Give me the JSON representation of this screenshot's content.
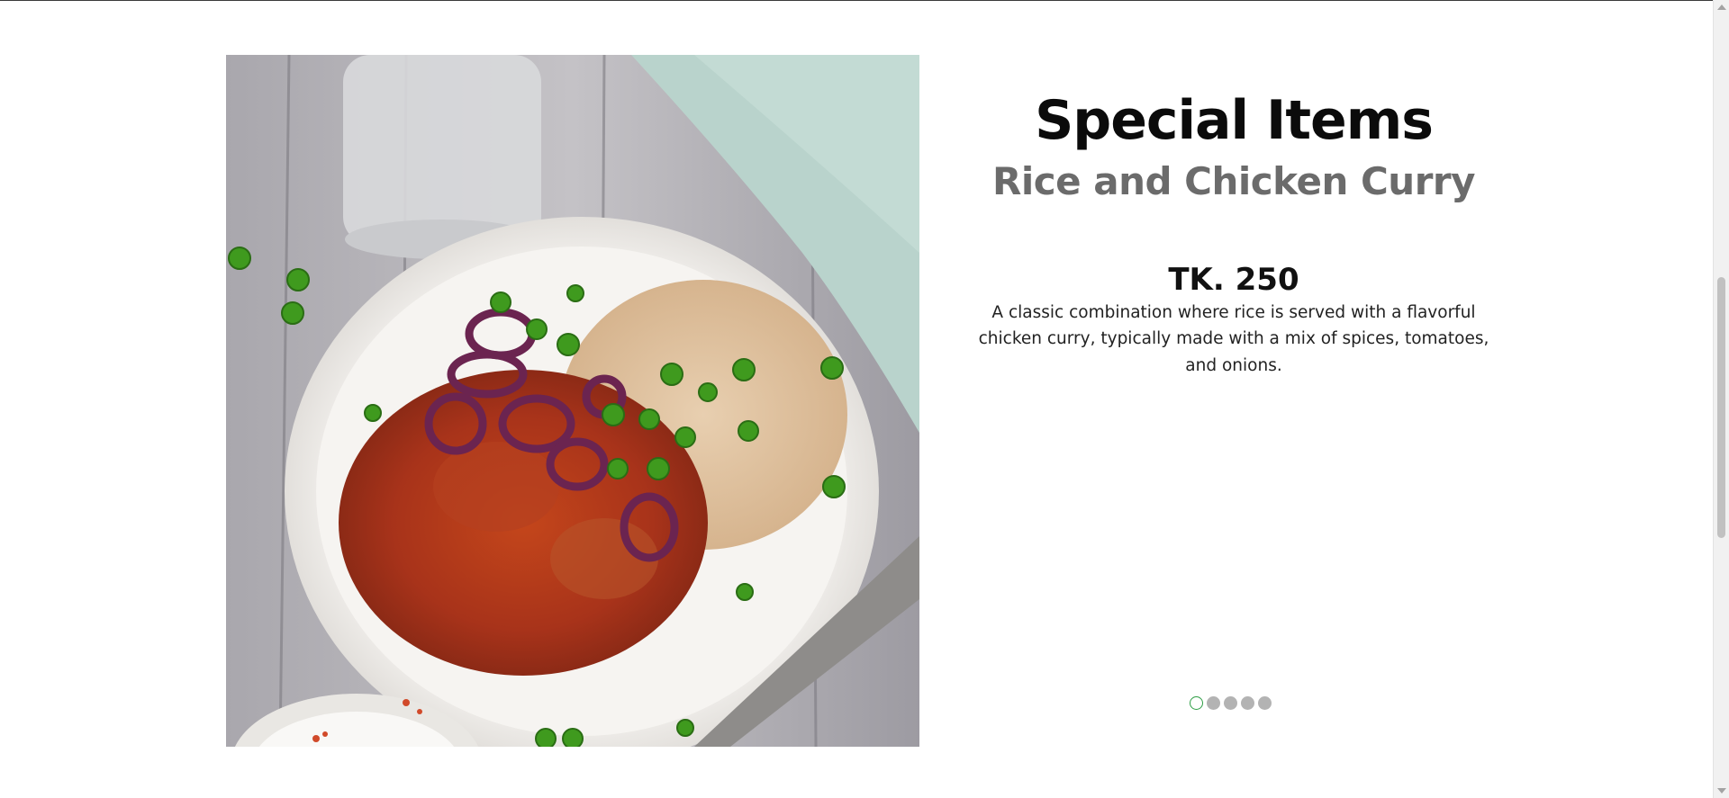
{
  "section": {
    "title": "Special Items"
  },
  "item": {
    "name": "Rice and Chicken Curry",
    "price": "TK. 250",
    "description": "A classic combination where rice is served with a flavorful chicken curry, typically made with a mix of spices, tomatoes, and onions.",
    "image_icon": "dish-photo"
  },
  "carousel": {
    "slide_count": 5,
    "active_index": 0,
    "active_color": "#2e9e45",
    "inactive_color": "#b3b3b3"
  }
}
